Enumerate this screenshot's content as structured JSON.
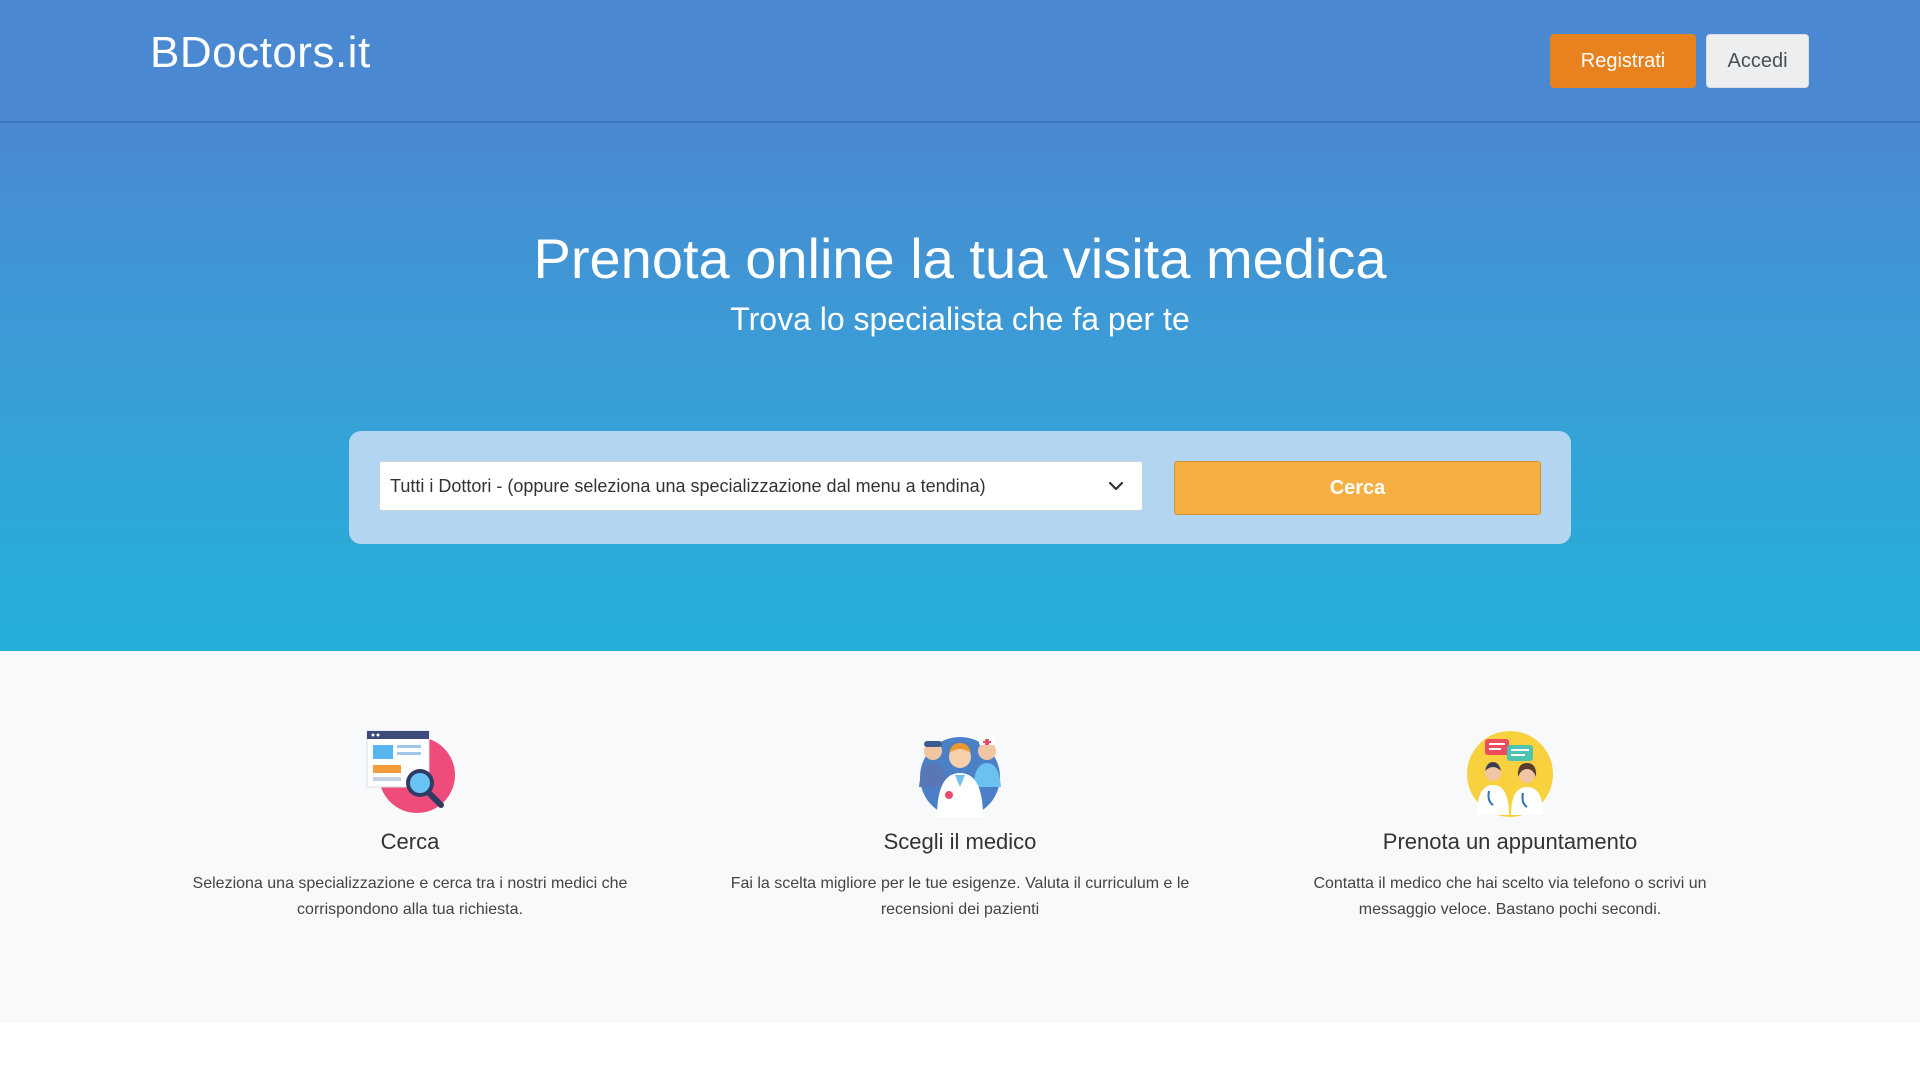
{
  "header": {
    "brand": "BDoctors.it",
    "register_label": "Registrati",
    "login_label": "Accedi"
  },
  "hero": {
    "title": "Prenota online la tua visita medica",
    "subtitle": "Trova lo specialista che fa per te",
    "select_value": "Tutti i Dottori - (oppure seleziona una specializzazione dal menu a tendina)",
    "search_label": "Cerca"
  },
  "features": [
    {
      "icon": "search-document-icon",
      "title": "Cerca",
      "text": "Seleziona una specializzazione e cerca tra i nostri medici che corrispondono alla tua richiesta."
    },
    {
      "icon": "doctors-team-icon",
      "title": "Scegli il medico",
      "text": "Fai la scelta migliore per le tue esigenze. Valuta il curriculum e le recensioni dei pazienti"
    },
    {
      "icon": "doctors-chat-icon",
      "title": "Prenota un appuntamento",
      "text": "Contatta il medico che hai scelto via telefono o scrivi un messaggio veloce. Bastano pochi secondi."
    }
  ],
  "colors": {
    "header_bg": "#4a89d2",
    "register": "#e8821f",
    "search_button": "#f6af43",
    "search_panel": "#b2d5f1"
  }
}
